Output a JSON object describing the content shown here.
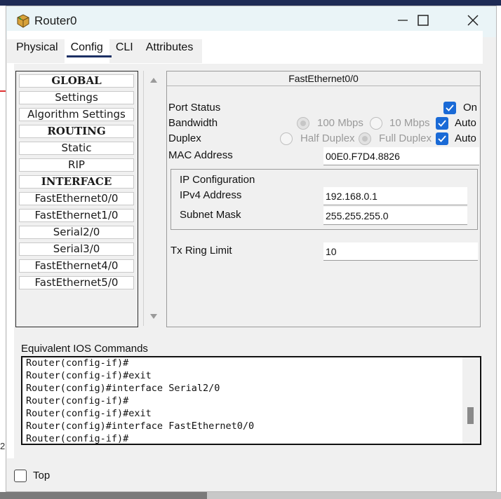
{
  "window": {
    "title": "Router0"
  },
  "tabs": [
    "Physical",
    "Config",
    "CLI",
    "Attributes"
  ],
  "active_tab": "Config",
  "nav": {
    "items": [
      {
        "label": "GLOBAL",
        "header": true
      },
      {
        "label": "Settings",
        "header": false
      },
      {
        "label": "Algorithm Settings",
        "header": false
      },
      {
        "label": "ROUTING",
        "header": true
      },
      {
        "label": "Static",
        "header": false
      },
      {
        "label": "RIP",
        "header": false
      },
      {
        "label": "INTERFACE",
        "header": true
      },
      {
        "label": "FastEthernet0/0",
        "header": false
      },
      {
        "label": "FastEthernet1/0",
        "header": false
      },
      {
        "label": "Serial2/0",
        "header": false
      },
      {
        "label": "Serial3/0",
        "header": false
      },
      {
        "label": "FastEthernet4/0",
        "header": false
      },
      {
        "label": "FastEthernet5/0",
        "header": false
      }
    ]
  },
  "interface": {
    "title": "FastEthernet0/0",
    "port_status_label": "Port Status",
    "port_on_label": "On",
    "port_on": true,
    "bandwidth_label": "Bandwidth",
    "bw_100_label": "100 Mbps",
    "bw_10_label": "10 Mbps",
    "bw_auto_label": "Auto",
    "bw_auto": true,
    "duplex_label": "Duplex",
    "half_duplex_label": "Half Duplex",
    "full_duplex_label": "Full Duplex",
    "duplex_auto_label": "Auto",
    "duplex_auto": true,
    "mac_label": "MAC Address",
    "mac_value": "00E0.F7D4.8826",
    "ip_config_label": "IP Configuration",
    "ipv4_label": "IPv4 Address",
    "ipv4_value": "192.168.0.1",
    "mask_label": "Subnet Mask",
    "mask_value": "255.255.255.0",
    "tx_label": "Tx Ring Limit",
    "tx_value": "10"
  },
  "ios": {
    "label": "Equivalent IOS Commands",
    "lines": [
      "Router(config-if)#",
      "Router(config-if)#exit",
      "Router(config)#interface Serial2/0",
      "Router(config-if)#",
      "Router(config-if)#exit",
      "Router(config)#interface FastEthernet0/0",
      "Router(config-if)#"
    ]
  },
  "footer": {
    "top_label": "Top",
    "top_checked": false
  },
  "colors": {
    "accent": "#1a6ad6",
    "tab_underline": "#1c2f64",
    "titlebar": "#eaf4f7"
  },
  "icons": [
    "router-icon",
    "minimize-icon",
    "maximize-icon",
    "close-icon",
    "checkmark-icon",
    "scroll-up-icon",
    "scroll-down-icon"
  ]
}
